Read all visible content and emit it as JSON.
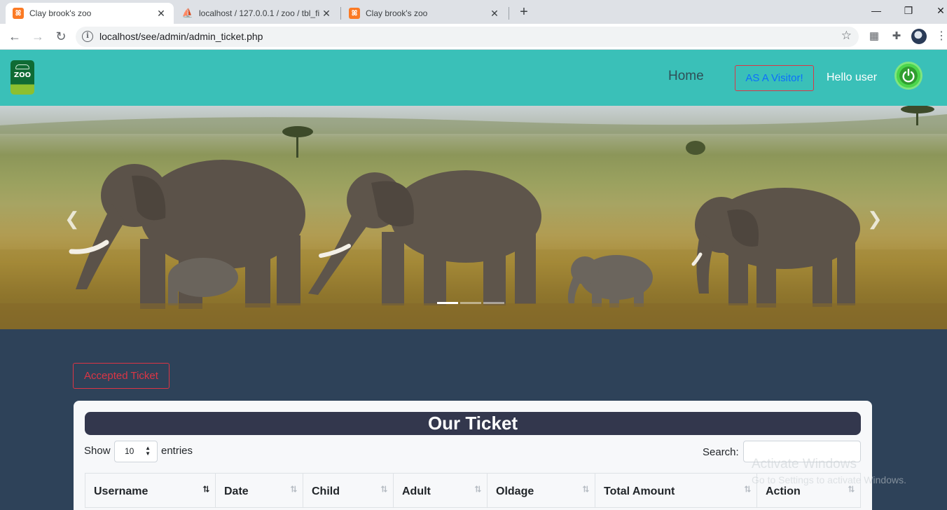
{
  "browser": {
    "tabs": [
      {
        "title": "Clay brook's zoo",
        "icon": "xampp-icon",
        "active": true
      },
      {
        "title": "localhost / 127.0.0.1 / zoo / tbl_fi",
        "icon": "phpmyadmin-icon",
        "active": false
      },
      {
        "title": "Clay brook's zoo",
        "icon": "xampp-icon",
        "active": false
      }
    ],
    "url": "localhost/see/admin/admin_ticket.php"
  },
  "header": {
    "logo_text": "ZOO",
    "nav_home": "Home",
    "visitor_button": "AS A Visitor!",
    "greeting": "Hello user"
  },
  "banner": {
    "slides_total": 3,
    "active_slide": 1
  },
  "main": {
    "accepted_button": "Accepted Ticket",
    "card_title": "Our Ticket",
    "show_label": "Show",
    "page_length": "10",
    "entries_label": "entries",
    "search_label": "Search:",
    "search_value": "",
    "columns": [
      {
        "label": "Username",
        "sort_icon": "⭡⭣",
        "sorted": true
      },
      {
        "label": "Date",
        "sort_icon": "⭡⭣",
        "sorted": false
      },
      {
        "label": "Child",
        "sort_icon": "⭡⭣",
        "sorted": false
      },
      {
        "label": "Adult",
        "sort_icon": "⭡⭣",
        "sorted": false
      },
      {
        "label": "Oldage",
        "sort_icon": "⭡⭣",
        "sorted": false
      },
      {
        "label": "Total Amount",
        "sort_icon": "⭡⭣",
        "sorted": false
      },
      {
        "label": "Action",
        "sort_icon": "⭡⭣",
        "sorted": false
      }
    ]
  },
  "watermark": {
    "line1": "Activate Windows",
    "line2": "Go to Settings to activate Windows."
  },
  "colors": {
    "header_bg": "#3ac0b8",
    "page_bg": "#2e4259",
    "title_bar": "#33374d",
    "danger": "#dc3545",
    "link": "#0d6efd"
  }
}
